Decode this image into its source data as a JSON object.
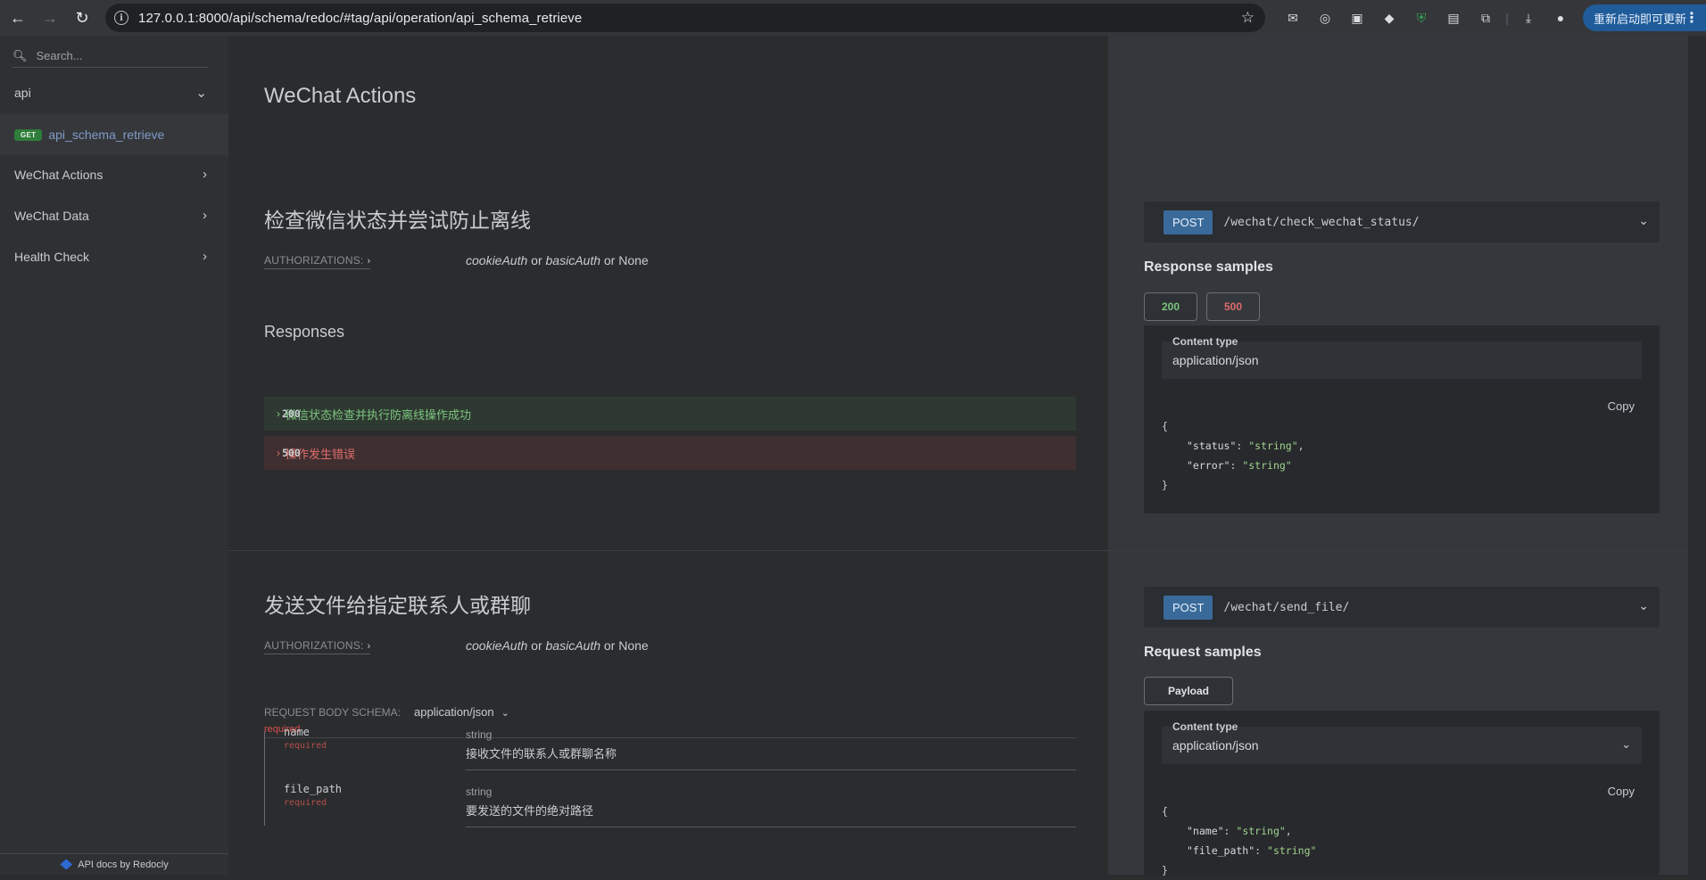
{
  "browser": {
    "url": "127.0.0.1:8000/api/schema/redoc/#tag/api/operation/api_schema_retrieve",
    "update_button": "重新启动即可更新"
  },
  "sidebar": {
    "search_placeholder": "Search...",
    "items": [
      {
        "label": "api"
      },
      {
        "label": "api_schema_retrieve",
        "method": "GET"
      },
      {
        "label": "WeChat Actions"
      },
      {
        "label": "WeChat Data"
      },
      {
        "label": "Health Check"
      }
    ],
    "footer": "API docs by Redocly"
  },
  "tag_title": "WeChat Actions",
  "op1": {
    "title": "检查微信状态并尝试防止离线",
    "auth_label": "AUTHORIZATIONS:",
    "auth_a": "cookieAuth",
    "auth_or1": "or",
    "auth_b": "basicAuth",
    "auth_or2": "or",
    "auth_none": "None",
    "responses_title": "Responses",
    "responses": [
      {
        "code": "200",
        "desc": "微信状态检查并执行防离线操作成功"
      },
      {
        "code": "500",
        "desc": "操作发生错误"
      }
    ],
    "method": "POST",
    "path": "/wechat/check_wechat_status/",
    "samples_title": "Response samples",
    "tabs": [
      "200",
      "500"
    ],
    "content_type_label": "Content type",
    "content_type": "application/json",
    "copy": "Copy",
    "code": {
      "open": "{",
      "line1_key": "\"status\"",
      "line1_val": "\"string\"",
      "line2_key": "\"error\"",
      "line2_val": "\"string\"",
      "close": "}"
    }
  },
  "op2": {
    "title": "发送文件给指定联系人或群聊",
    "auth_label": "AUTHORIZATIONS:",
    "auth_a": "cookieAuth",
    "auth_or1": "or",
    "auth_b": "basicAuth",
    "auth_or2": "or",
    "auth_none": "None",
    "body_schema_label": "REQUEST BODY SCHEMA:",
    "body_schema_value": "application/json",
    "required": "required",
    "params": [
      {
        "name": "name",
        "req": "required",
        "type": "string",
        "desc": "接收文件的联系人或群聊名称"
      },
      {
        "name": "file_path",
        "req": "required",
        "type": "string",
        "desc": "要发送的文件的绝对路径"
      }
    ],
    "method": "POST",
    "path": "/wechat/send_file/",
    "samples_title": "Request samples",
    "tab": "Payload",
    "content_type_label": "Content type",
    "content_type": "application/json",
    "copy": "Copy",
    "code": {
      "open": "{",
      "line1_key": "\"name\"",
      "line1_val": "\"string\"",
      "line2_key": "\"file_path\"",
      "line2_val": "\"string\"",
      "close": "}"
    }
  }
}
